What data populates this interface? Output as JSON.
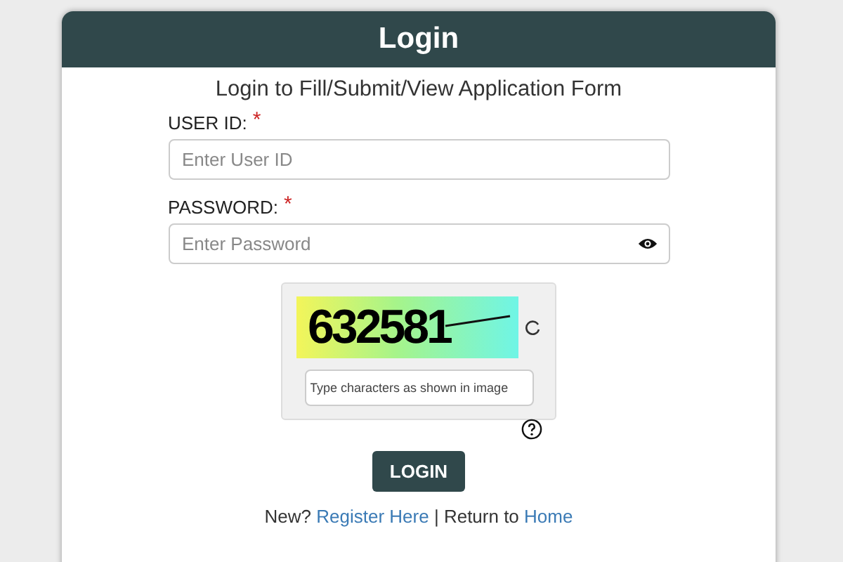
{
  "header": {
    "title": "Login"
  },
  "subtitle": "Login to Fill/Submit/View Application Form",
  "fields": [
    {
      "label": "USER ID:",
      "required_mark": "*",
      "placeholder": "Enter User ID",
      "kind": "text"
    },
    {
      "label": "PASSWORD:",
      "required_mark": "*",
      "placeholder": "Enter Password",
      "kind": "password"
    }
  ],
  "captcha": {
    "code": "632581",
    "placeholder": "Type characters as shown in image"
  },
  "login_button": "LOGIN",
  "footer": {
    "prefix": "New?",
    "register_link": "Register Here",
    "separator": "|",
    "middle": "Return to",
    "home_link": "Home"
  }
}
